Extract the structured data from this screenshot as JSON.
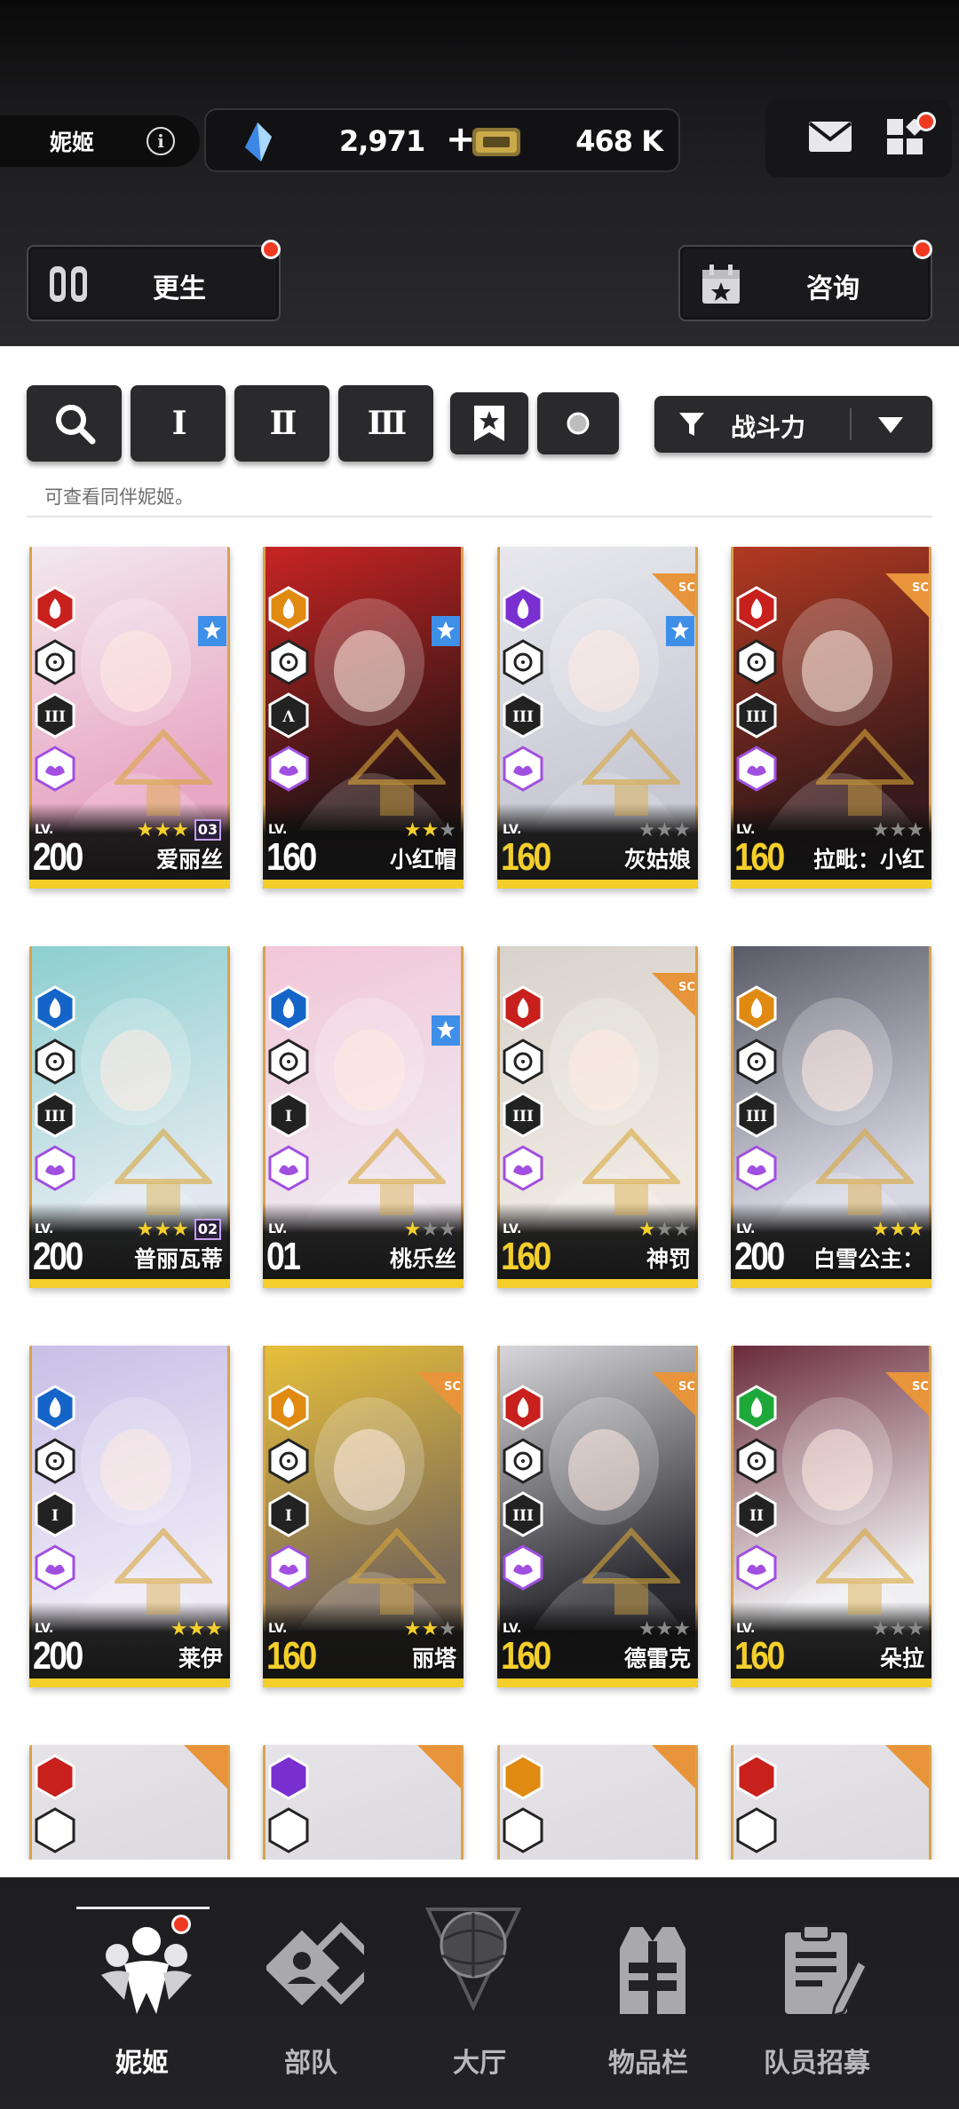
{
  "header": {
    "player_name": "妮姬",
    "gems": "2,971",
    "gems_plus": "+",
    "credits": "468 K",
    "rebirth_label": "更生",
    "consult_label": "咨询"
  },
  "filters": {
    "burst_1": "I",
    "burst_2": "II",
    "burst_3": "III",
    "sort_label": "战斗力",
    "hint": "可查看同伴妮姬。"
  },
  "cards": [
    {
      "name": "爱丽丝",
      "level": "200",
      "lv_label": "LV.",
      "stars": 3,
      "limit_break": "03"
    },
    {
      "name": "小红帽",
      "level": "160",
      "lv_label": "LV.",
      "stars": 2
    },
    {
      "name": "灰姑娘",
      "level": "160",
      "lv_label": "LV.",
      "stars": 0
    },
    {
      "name": "拉毗：小红",
      "level": "160",
      "lv_label": "LV.",
      "stars": 0
    },
    {
      "name": "普丽瓦蒂",
      "level": "200",
      "lv_label": "LV.",
      "stars": 3,
      "limit_break": "02"
    },
    {
      "name": "桃乐丝",
      "level": "01",
      "lv_label": "LV.",
      "stars": 1
    },
    {
      "name": "神罚",
      "level": "160",
      "lv_label": "LV.",
      "stars": 1
    },
    {
      "name": "白雪公主：",
      "level": "200",
      "lv_label": "LV.",
      "stars": 3
    },
    {
      "name": "莱伊",
      "level": "200",
      "lv_label": "LV.",
      "stars": 3
    },
    {
      "name": "丽塔",
      "level": "160",
      "lv_label": "LV.",
      "stars": 2
    },
    {
      "name": "德雷克",
      "level": "160",
      "lv_label": "LV.",
      "stars": 0
    },
    {
      "name": "朵拉",
      "level": "160",
      "lv_label": "LV.",
      "stars": 0
    }
  ],
  "nav": {
    "nikke": "妮姬",
    "squad": "部队",
    "lobby": "大厅",
    "inventory": "物品栏",
    "recruit": "队员招募"
  },
  "colors": {
    "fire": "#c8201d",
    "water": "#1565c8",
    "electric": "#7a2fd1",
    "iron": "#e08a12",
    "wind": "#1fa83a",
    "burst_purple": "#a14fe0",
    "star_gold": "#f4cf2b",
    "notif_red": "#ef3a22"
  }
}
